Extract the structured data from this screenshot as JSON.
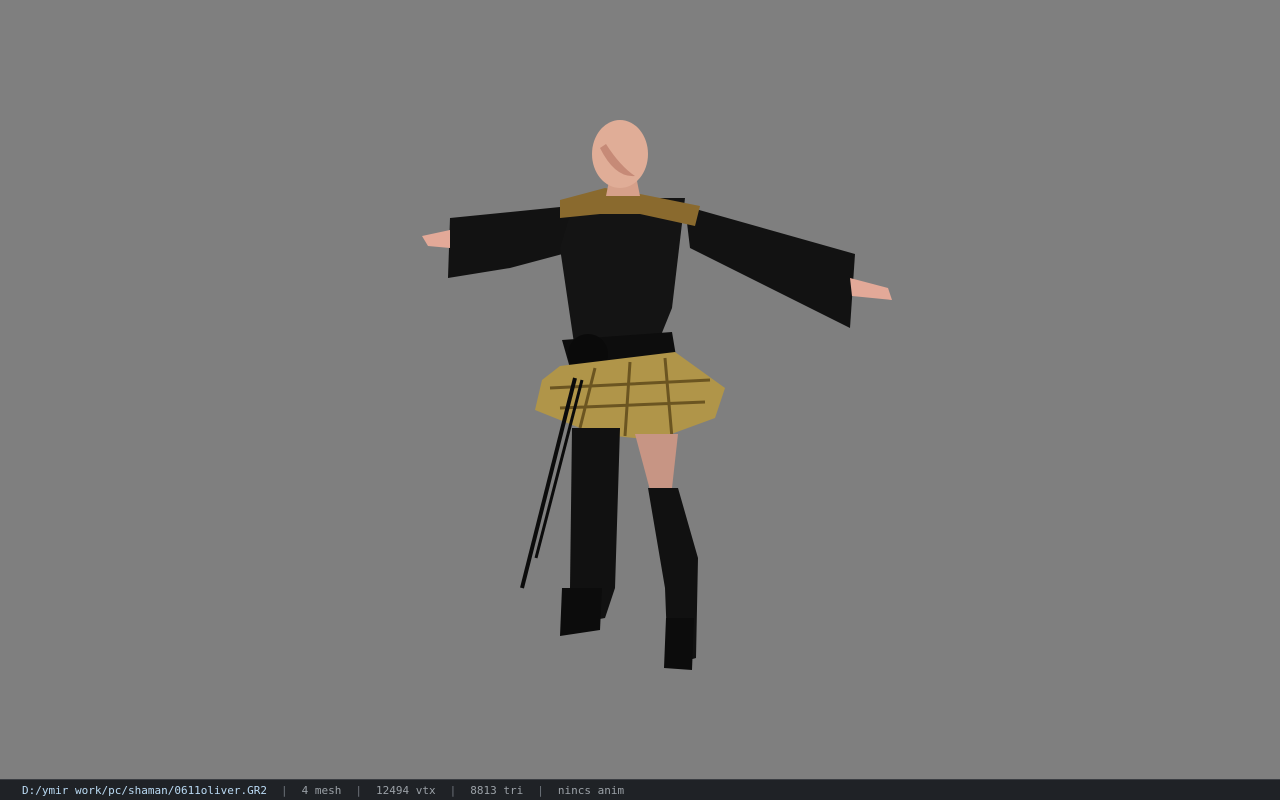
{
  "status": {
    "file_path": "D:/ymir work/pc/shaman/0611oliver.GR2",
    "separator": "|",
    "mesh_count": "4 mesh",
    "vertex_count": "12494 vtx",
    "triangle_count": "8813 tri",
    "anim": "nincs anim"
  },
  "colors": {
    "viewport_bg": "#7f7f7f",
    "statusbar_bg": "#1f2226",
    "path_text": "#b9d9f2",
    "status_text": "#9aa0a6"
  }
}
